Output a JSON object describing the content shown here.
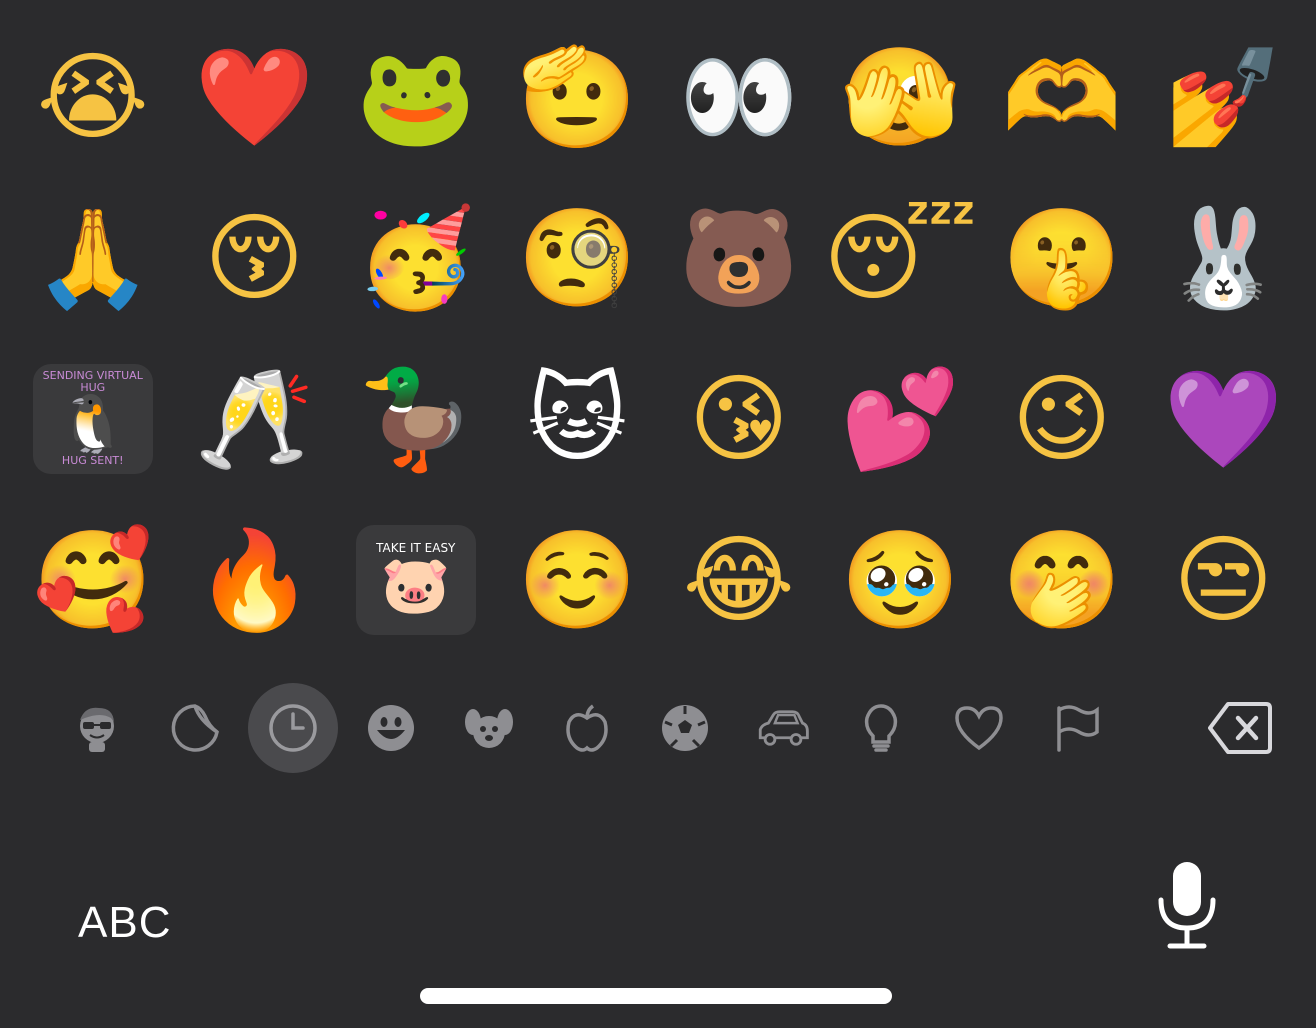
{
  "emoji_grid": [
    [
      "😭",
      "❤️",
      "🐸",
      "🫡",
      "👀",
      "🫣",
      "🫶",
      "💅"
    ],
    [
      "🙏",
      "😚",
      "🥳",
      "🧐",
      "🐻",
      "😴",
      "🤫",
      "🐰"
    ],
    [
      "🐧",
      "🥂",
      "🦆",
      "🐱",
      "😘",
      "💕",
      "😉",
      "💜"
    ],
    [
      "🥰",
      "🔥",
      "🐷",
      "☺️",
      "😂",
      "🥹",
      "🤭",
      "😒"
    ]
  ],
  "sticker_texts": {
    "penguin_top": "SENDING VIRTUAL HUG",
    "penguin_bottom": "HUG SENT!",
    "take_it_easy": "TAKE IT EASY"
  },
  "category_bar": {
    "items": [
      {
        "name": "memoji",
        "icon": "memoji-icon"
      },
      {
        "name": "stickers",
        "icon": "sticker-icon"
      },
      {
        "name": "frequently-used",
        "icon": "clock-icon",
        "selected": true
      },
      {
        "name": "smileys",
        "icon": "smiley-icon"
      },
      {
        "name": "animals",
        "icon": "dog-icon"
      },
      {
        "name": "food",
        "icon": "apple-icon"
      },
      {
        "name": "activity",
        "icon": "soccer-ball-icon"
      },
      {
        "name": "travel",
        "icon": "car-icon"
      },
      {
        "name": "objects",
        "icon": "lightbulb-icon"
      },
      {
        "name": "symbols",
        "icon": "heart-icon"
      },
      {
        "name": "flags",
        "icon": "flag-icon"
      }
    ],
    "delete_icon": "delete-backspace-icon"
  },
  "bottom_bar": {
    "abc_label": "ABC",
    "mic_icon": "microphone-icon"
  },
  "colors": {
    "background": "#2b2b2d",
    "icon_gray": "#8e8e92",
    "selected_bg": "#4a4a4d",
    "text": "#ffffff"
  }
}
